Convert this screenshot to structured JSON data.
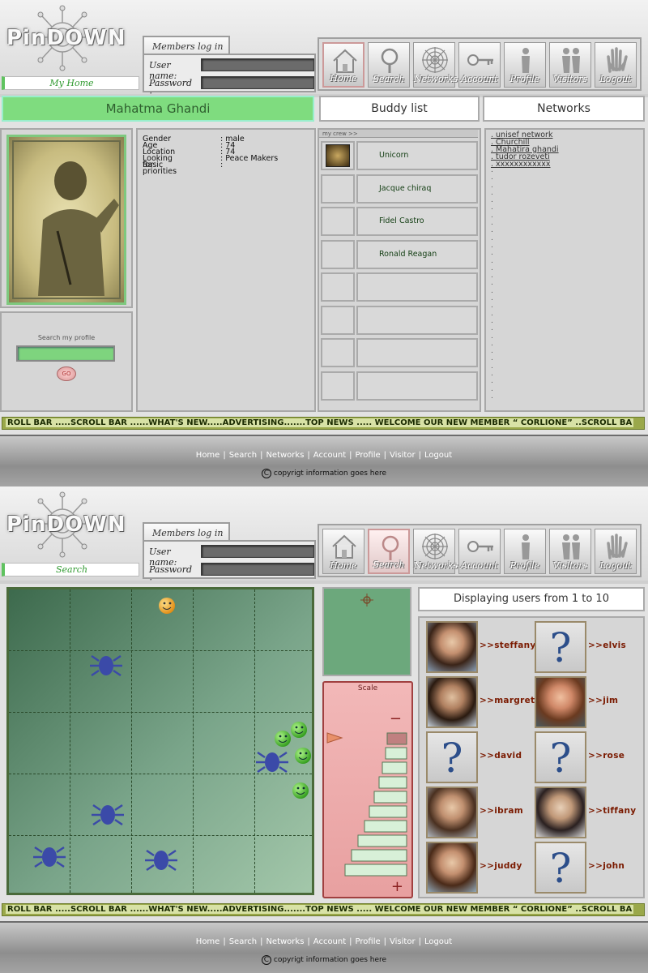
{
  "brand": {
    "logo_text": "PinDOWN"
  },
  "login": {
    "tab_label": "Members log in",
    "username_label": "User name:",
    "password_label": "Password :"
  },
  "nav": [
    {
      "label": "Home",
      "icon": "house-icon"
    },
    {
      "label": "Search",
      "icon": "magnifier-icon"
    },
    {
      "label": "Networks",
      "icon": "spiderweb-icon"
    },
    {
      "label": "Account",
      "icon": "key-icon"
    },
    {
      "label": "Profile",
      "icon": "person-icon"
    },
    {
      "label": "Visitors",
      "icon": "people-icon"
    },
    {
      "label": "Logout",
      "icon": "hand-icon"
    }
  ],
  "scroll_bar": {
    "text": "ROLL BAR .....SCROLL BAR ......WHAT'S NEW.....ADVERTISING.......TOP NEWS .....  WELCOME OUR NEW MEMBER “ CORLIONE” ..SCROLL BA"
  },
  "footer": {
    "links": [
      "Home",
      "Search",
      "Networks",
      "Account",
      "Profile",
      "Visitor",
      "Logout"
    ],
    "separator": "|",
    "copyright_symbol": "C",
    "copyright": "copyrigt information goes here"
  },
  "profile_page": {
    "page_label": "My Home",
    "active_nav": "Home",
    "profile_name": "Mahatma Ghandi",
    "buddy_list_title": "Buddy list",
    "networks_title": "Networks",
    "details": [
      {
        "key": "Gender",
        "value": ": male"
      },
      {
        "key": "Age",
        "value": ": 74"
      },
      {
        "key": "Location",
        "value": ": 74"
      },
      {
        "key": "Looking for",
        "value": ": Peace Makers"
      },
      {
        "key": "Basic priorities",
        "value": ":"
      }
    ],
    "search_profile_label": "Search my profile",
    "go_label": "GO",
    "crew_label": "my crew >>",
    "buddies": [
      "Unicorn",
      "Jacque chiraq",
      "Fidel Castro",
      "Ronald Reagan",
      "",
      "",
      "",
      ""
    ],
    "networks": [
      ". unisef network",
      ". Churchill",
      ". Mahatira ghandi",
      ". tudor rozeveti",
      ". xxxxxxxxxxxx"
    ],
    "dot_count": 31
  },
  "search_page": {
    "page_label": "Search",
    "active_nav": "Search",
    "scale_label": "Scale",
    "scale_minus": "−",
    "scale_plus": "+",
    "display_text": "Displaying users from 1 to 10",
    "users": [
      {
        "name": ">>steffany",
        "has_photo": true
      },
      {
        "name": ">>elvis",
        "has_photo": false
      },
      {
        "name": ">>margret",
        "has_photo": true
      },
      {
        "name": ">>jim",
        "has_photo": true
      },
      {
        "name": ">>david",
        "has_photo": false
      },
      {
        "name": ">>rose",
        "has_photo": false
      },
      {
        "name": ">>ibram",
        "has_photo": true
      },
      {
        "name": ">>tiffany",
        "has_photo": true
      },
      {
        "name": ">>juddy",
        "has_photo": true
      },
      {
        "name": ">>john",
        "has_photo": false
      }
    ],
    "unknown_user_glyph": "?"
  },
  "colors": {
    "accent_green": "#5fc35f",
    "scroll_bar": "#9aa84a",
    "user_name": "#7a1a00"
  }
}
